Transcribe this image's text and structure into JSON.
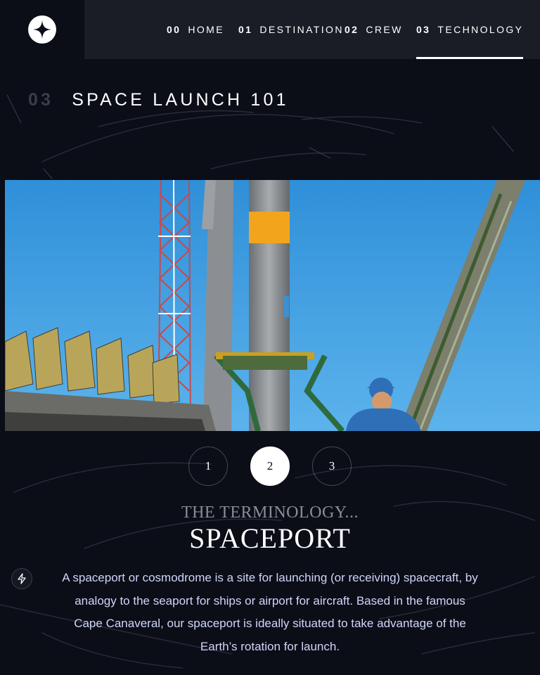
{
  "nav": {
    "items": [
      {
        "num": "00",
        "label": "HOME"
      },
      {
        "num": "01",
        "label": "DESTINATION"
      },
      {
        "num": "02",
        "label": "CREW"
      },
      {
        "num": "03",
        "label": "TECHNOLOGY"
      }
    ],
    "active_index": 3
  },
  "page": {
    "num": "03",
    "title": "SPACE LAUNCH 101"
  },
  "pager": {
    "buttons": [
      "1",
      "2",
      "3"
    ],
    "active_index": 1
  },
  "technology": {
    "kicker": "THE TERMINOLOGY...",
    "name": "SPACEPORT",
    "description": "A spaceport or cosmodrome is a site for launching (or receiving) spacecraft, by analogy to the seaport for ships or airport for aircraft. Based in the famous Cape Canaveral, our spaceport is ideally situated to take advantage of the Earth’s rotation for launch."
  },
  "icons": {
    "logo": "star-logo-icon",
    "floating": "bolt-icon"
  },
  "colors": {
    "background": "#0b0d17",
    "nav_background": "#1a1c26",
    "text_light": "#d0d6f9",
    "accent": "#ffffff"
  }
}
